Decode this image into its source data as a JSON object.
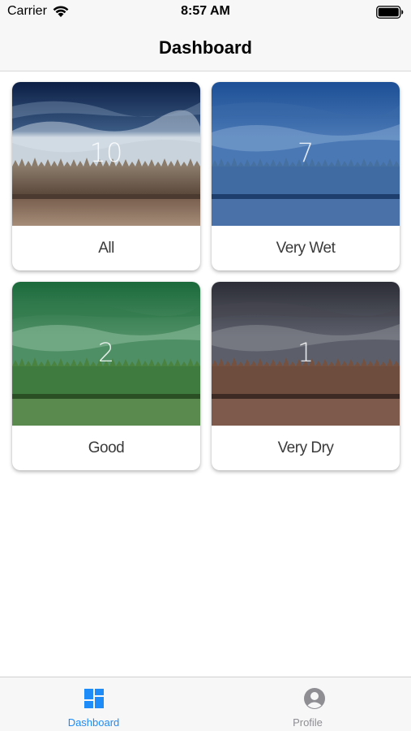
{
  "status_bar": {
    "carrier": "Carrier",
    "time": "8:57 AM"
  },
  "nav": {
    "title": "Dashboard"
  },
  "cards": [
    {
      "count": "10",
      "label": "All",
      "tint": "#1a3a6b"
    },
    {
      "count": "7",
      "label": "Very Wet",
      "tint": "#1f5aa6"
    },
    {
      "count": "2",
      "label": "Good",
      "tint": "#1e6b3a"
    },
    {
      "count": "1",
      "label": "Very Dry",
      "tint": "#3a3a42"
    }
  ],
  "tab_bar": {
    "tabs": [
      {
        "label": "Dashboard",
        "icon": "dashboard-icon",
        "active": true,
        "color": "#1d8cf8"
      },
      {
        "label": "Profile",
        "icon": "profile-icon",
        "active": false,
        "color": "#8e8e93"
      }
    ]
  }
}
